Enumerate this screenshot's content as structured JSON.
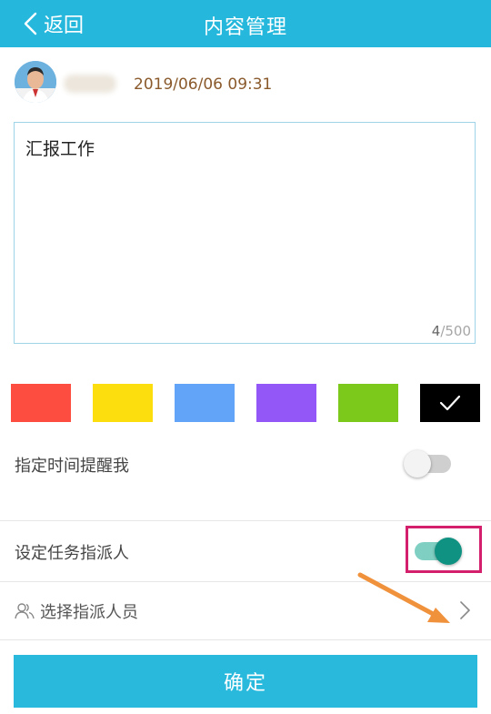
{
  "header": {
    "back_label": "返回",
    "title": "内容管理"
  },
  "post": {
    "timestamp": "2019/06/06 09:31"
  },
  "editor": {
    "text": "汇报工作",
    "count": "4",
    "max": "/500"
  },
  "colors": [
    {
      "name": "red",
      "hex": "#fc4d40",
      "selected": false
    },
    {
      "name": "yellow",
      "hex": "#fcdd0e",
      "selected": false
    },
    {
      "name": "blue",
      "hex": "#62a5f8",
      "selected": false
    },
    {
      "name": "purple",
      "hex": "#9457f7",
      "selected": false
    },
    {
      "name": "green",
      "hex": "#7cc91c",
      "selected": false
    },
    {
      "name": "black",
      "hex": "#000000",
      "selected": true
    }
  ],
  "reminder": {
    "label": "指定时间提醒我",
    "enabled": false
  },
  "assignee": {
    "label": "设定任务指派人",
    "enabled": true
  },
  "select_assignee": {
    "label": "选择指派人员"
  },
  "confirm_label": "确定"
}
